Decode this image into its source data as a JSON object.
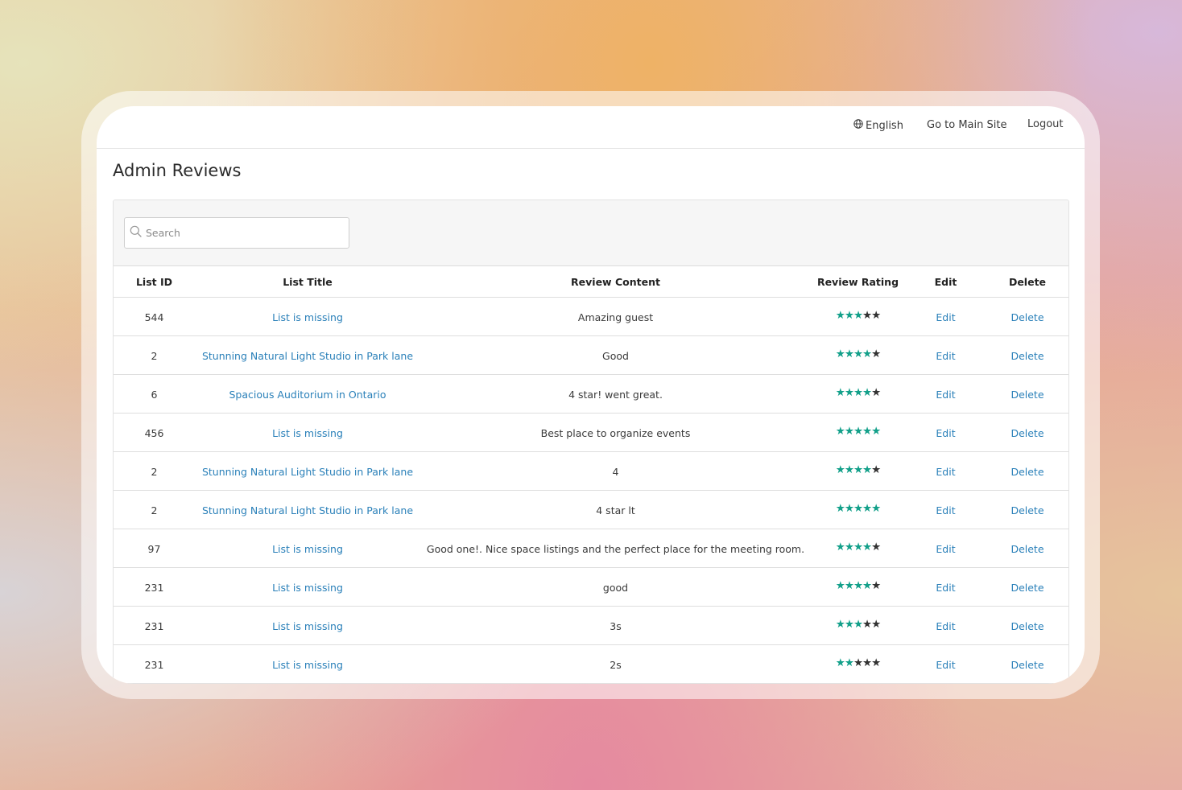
{
  "topbar": {
    "language_label": "English",
    "main_site_label": "Go to Main Site",
    "logout_label": "Logout"
  },
  "page_title": "Admin Reviews",
  "search": {
    "placeholder": "Search",
    "value": ""
  },
  "table": {
    "columns": [
      "List ID",
      "List Title",
      "Review Content",
      "Review Rating",
      "Edit",
      "Delete"
    ],
    "rows": [
      {
        "list_id": "544",
        "list_title": "List is missing",
        "content": "Amazing guest",
        "rating": 3,
        "edit": "Edit",
        "delete": "Delete"
      },
      {
        "list_id": "2",
        "list_title": "Stunning Natural Light Studio in Park lane",
        "content": "Good",
        "rating": 4,
        "edit": "Edit",
        "delete": "Delete"
      },
      {
        "list_id": "6",
        "list_title": "Spacious Auditorium in Ontario",
        "content": "4 star! went great.",
        "rating": 4,
        "edit": "Edit",
        "delete": "Delete"
      },
      {
        "list_id": "456",
        "list_title": "List is missing",
        "content": "Best place to organize events",
        "rating": 5,
        "edit": "Edit",
        "delete": "Delete"
      },
      {
        "list_id": "2",
        "list_title": "Stunning Natural Light Studio in Park lane",
        "content": "4",
        "rating": 4,
        "edit": "Edit",
        "delete": "Delete"
      },
      {
        "list_id": "2",
        "list_title": "Stunning Natural Light Studio in Park lane",
        "content": "4 star lt",
        "rating": 5,
        "edit": "Edit",
        "delete": "Delete"
      },
      {
        "list_id": "97",
        "list_title": "List is missing",
        "content": "Good one!. Nice space listings and the perfect place for the meeting room.",
        "rating": 4,
        "edit": "Edit",
        "delete": "Delete"
      },
      {
        "list_id": "231",
        "list_title": "List is missing",
        "content": "good",
        "rating": 4,
        "edit": "Edit",
        "delete": "Delete"
      },
      {
        "list_id": "231",
        "list_title": "List is missing",
        "content": "3s",
        "rating": 3,
        "edit": "Edit",
        "delete": "Delete"
      },
      {
        "list_id": "231",
        "list_title": "List is missing",
        "content": "2s",
        "rating": 2,
        "edit": "Edit",
        "delete": "Delete"
      }
    ],
    "max_rating": 5
  },
  "icons": {
    "language": "globe-icon",
    "search": "search-icon",
    "rating": "star-icon"
  },
  "colors": {
    "link": "#2a80b9",
    "star_filled": "#13a08a",
    "star_empty": "#333333",
    "toolbar_bg": "#f6f6f6"
  }
}
